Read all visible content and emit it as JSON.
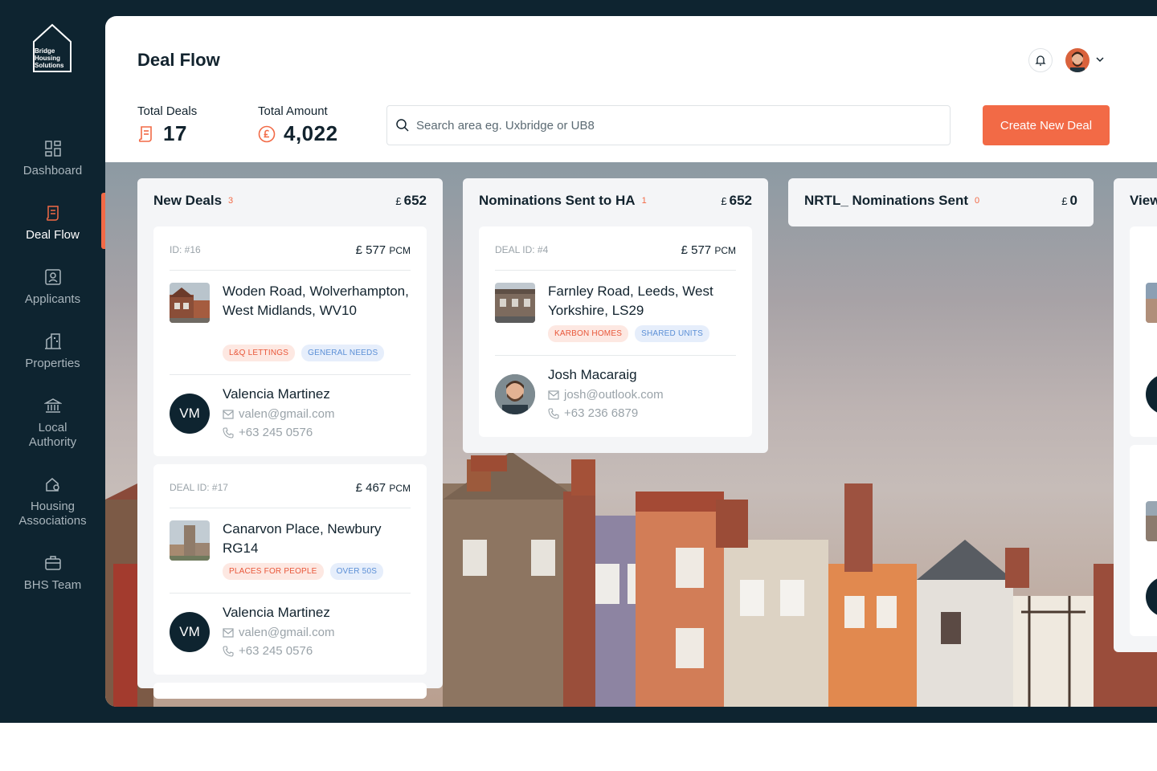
{
  "brand": {
    "logo_line1": "Bridge",
    "logo_line2": "Housing",
    "logo_line3": "Solutions",
    "accent": "#f26a46",
    "dark": "#0e2430"
  },
  "sidebar": {
    "items": [
      {
        "label": "Dashboard",
        "icon": "grid-icon"
      },
      {
        "label": "Deal Flow",
        "icon": "document-icon",
        "active": true
      },
      {
        "label": "Applicants",
        "icon": "user-badge-icon"
      },
      {
        "label": "Properties",
        "icon": "building-icon"
      },
      {
        "label": "Local Authority",
        "icon": "bank-icon"
      },
      {
        "label": "Housing Associations",
        "icon": "house-people-icon"
      },
      {
        "label": "BHS Team",
        "icon": "briefcase-icon"
      }
    ]
  },
  "header": {
    "title": "Deal Flow"
  },
  "stats": {
    "total_deals_label": "Total Deals",
    "total_deals": "17",
    "total_amount_label": "Total Amount",
    "total_amount": "4,022"
  },
  "search": {
    "placeholder": "Search area eg. Uxbridge or UB8"
  },
  "create_button": "Create New Deal",
  "columns": [
    {
      "title": "New Deals",
      "count": "3",
      "currency": "£",
      "amount": "652",
      "cards": [
        {
          "id": "ID: #16",
          "currency": "£",
          "price": "577",
          "unit": "PCM",
          "address": "Woden Road, Wolverhampton, West Midlands, WV10",
          "tags": [
            "L&Q LETTINGS",
            "GENERAL NEEDS"
          ],
          "contact": {
            "initials": "VM",
            "name": "Valencia Martinez",
            "email": "valen@gmail.com",
            "phone": "+63 245 0576"
          }
        },
        {
          "id": "DEAL ID: #17",
          "currency": "£",
          "price": "467",
          "unit": "PCM",
          "address": "Canarvon Place, Newbury RG14",
          "tags": [
            "PLACES FOR PEOPLE",
            "OVER 50S"
          ],
          "contact": {
            "initials": "VM",
            "name": "Valencia Martinez",
            "email": "valen@gmail.com",
            "phone": "+63 245 0576"
          }
        }
      ]
    },
    {
      "title": "Nominations Sent to HA",
      "count": "1",
      "currency": "£",
      "amount": "652",
      "cards": [
        {
          "id": "DEAL ID: #4",
          "currency": "£",
          "price": "577",
          "unit": "PCM",
          "address": "Farnley Road, Leeds, West Yorkshire, LS29",
          "tags": [
            "KARBON HOMES",
            "SHARED UNITS"
          ],
          "contact": {
            "name": "Josh Macaraig",
            "email": "josh@outlook.com",
            "phone": "+63 236 6879"
          }
        }
      ]
    },
    {
      "title": "NRTL_ Nominations Sent",
      "count": "0",
      "currency": "£",
      "amount": "0"
    },
    {
      "title": "View"
    }
  ]
}
